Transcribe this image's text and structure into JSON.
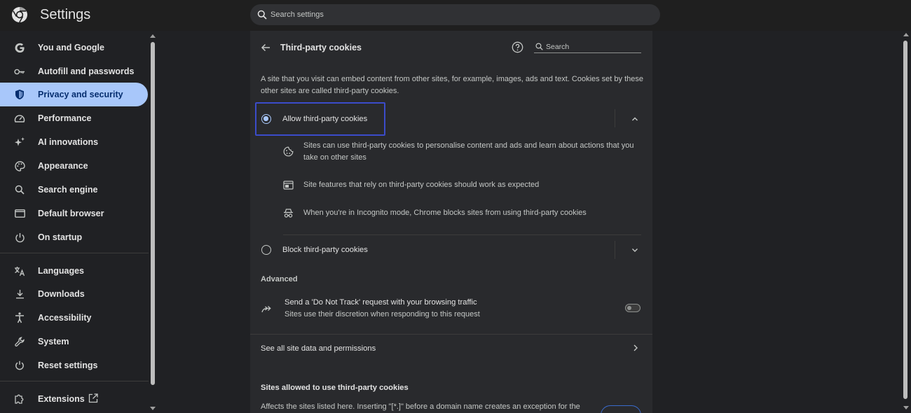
{
  "header": {
    "title": "Settings",
    "search_placeholder": "Search settings",
    "logo_icon": "chrome-logo-icon"
  },
  "sidebar": {
    "items": [
      {
        "label": "You and Google",
        "icon": "google-g-icon"
      },
      {
        "label": "Autofill and passwords",
        "icon": "key-icon"
      },
      {
        "label": "Privacy and security",
        "icon": "shield-icon",
        "active": true
      },
      {
        "label": "Performance",
        "icon": "speedometer-icon"
      },
      {
        "label": "AI innovations",
        "icon": "sparkle-icon"
      },
      {
        "label": "Appearance",
        "icon": "palette-icon"
      },
      {
        "label": "Search engine",
        "icon": "search-icon"
      },
      {
        "label": "Default browser",
        "icon": "browser-window-icon"
      },
      {
        "label": "On startup",
        "icon": "power-icon"
      },
      {
        "label": "Languages",
        "icon": "translate-icon"
      },
      {
        "label": "Downloads",
        "icon": "download-icon"
      },
      {
        "label": "Accessibility",
        "icon": "accessibility-icon"
      },
      {
        "label": "System",
        "icon": "wrench-icon"
      },
      {
        "label": "Reset settings",
        "icon": "reset-icon"
      },
      {
        "label": "Extensions",
        "icon": "puzzle-icon"
      }
    ]
  },
  "page": {
    "title": "Third-party cookies",
    "search_placeholder": "Search",
    "description": "A site that you visit can embed content from other sites, for example, images, ads and text. Cookies set by these other sites are called third-party cookies.",
    "options": [
      {
        "label": "Allow third-party cookies",
        "selected": true,
        "expanded": true,
        "details": [
          {
            "icon": "cookie-icon",
            "text": "Sites can use third-party cookies to personalise content and ads and learn about actions that you take on other sites"
          },
          {
            "icon": "web-page-icon",
            "text": "Site features that rely on third-party cookies should work as expected"
          },
          {
            "icon": "incognito-icon",
            "text": "When you're in Incognito mode, Chrome blocks sites from using third-party cookies"
          }
        ]
      },
      {
        "label": "Block third-party cookies",
        "selected": false,
        "expanded": false
      }
    ],
    "advanced": {
      "heading": "Advanced",
      "dnt_title": "Send a 'Do Not Track' request with your browsing traffic",
      "dnt_subtitle": "Sites use their discretion when responding to this request",
      "dnt_enabled": false
    },
    "site_data_link": "See all site data and permissions",
    "allowed_heading": "Sites allowed to use third-party cookies",
    "allowed_desc": "Affects the sites listed here. Inserting \"[*.]\" before a domain name creates an exception for the"
  },
  "colors": {
    "background": "#202124",
    "card": "#292a2d",
    "accent": "#a8c7fa",
    "focus_ring": "#3b4cca"
  }
}
